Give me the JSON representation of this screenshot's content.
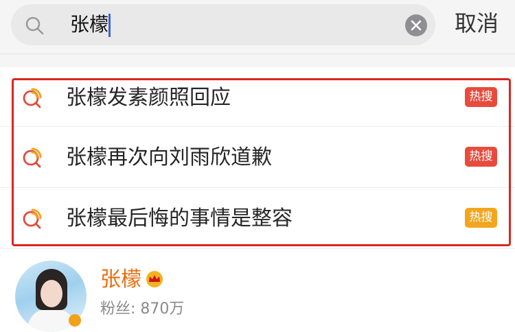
{
  "search": {
    "query": "张檬",
    "cancel_label": "取消"
  },
  "suggestions": [
    {
      "text": "张檬发素颜照回应",
      "badge": "热搜",
      "badge_color": "#e84b3c"
    },
    {
      "text": "张檬再次向刘雨欣道歉",
      "badge": "热搜",
      "badge_color": "#e84b3c"
    },
    {
      "text": "张檬最后悔的事情是整容",
      "badge": "热搜",
      "badge_color": "#f2a51d"
    }
  ],
  "user_card": {
    "name": "张檬",
    "fans_label": "粉丝: 870万",
    "name_color": "#e86e0f"
  },
  "icons": {
    "search": "search-icon",
    "clear": "clear-icon",
    "suggestion": "hot-search-icon",
    "crown": "crown-icon"
  },
  "highlight_color": "#d9261f"
}
